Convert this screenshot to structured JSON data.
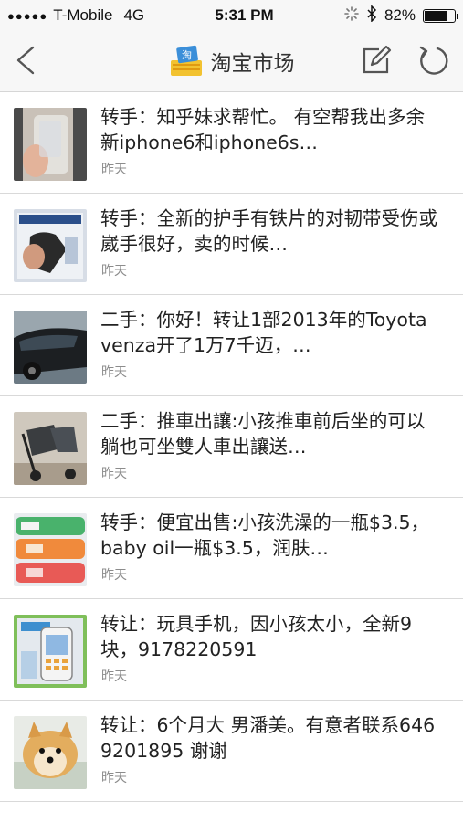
{
  "status_bar": {
    "carrier": "T-Mobile",
    "network": "4G",
    "time": "5:31 PM",
    "battery_percent": "82%",
    "battery_level": 0.82
  },
  "nav": {
    "title": "淘宝市场",
    "back_icon": "chevron-left-icon",
    "edit_icon": "compose-icon",
    "refresh_icon": "refresh-icon",
    "logo_text": "淘"
  },
  "posts": [
    {
      "title": "转手：知乎妹求帮忙。 有空帮我出多余新iphone6和iphone6s…",
      "time": "昨天",
      "thumb": "phone-case"
    },
    {
      "title": "转手：全新的护手有铁片的对韧带受伤或崴手很好，卖的时候…",
      "time": "昨天",
      "thumb": "wrist-brace"
    },
    {
      "title": "二手：你好！转让1部2013年的Toyota venza开了1万7千迈，…",
      "time": "昨天",
      "thumb": "car"
    },
    {
      "title": "二手：推車出讓:小孩推車前后坐的可以躺也可坐雙人車出讓送…",
      "time": "昨天",
      "thumb": "stroller"
    },
    {
      "title": "转手：便宜出售:小孩洗澡的一瓶$3.5，baby oil一瓶$3.5，润肤…",
      "time": "昨天",
      "thumb": "bottles"
    },
    {
      "title": "转让：玩具手机，因小孩太小，全新9块，9178220591",
      "time": "昨天",
      "thumb": "toy-phone"
    },
    {
      "title": "转让：6个月大 男潘美。有意者联系6469201895 谢谢",
      "time": "昨天",
      "thumb": "dog"
    }
  ]
}
